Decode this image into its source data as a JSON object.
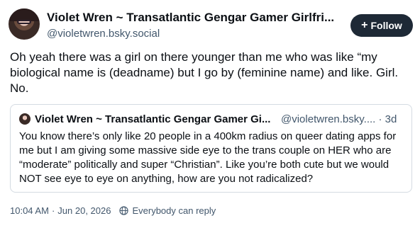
{
  "author": {
    "display_name": "Violet Wren ~ Transatlantic Gengar Gamer Girlfri...",
    "handle": "@violetwren.bsky.social"
  },
  "follow_button": {
    "icon": "plus-icon",
    "label": "Follow",
    "background": "#1e2936"
  },
  "post": {
    "text": "Oh yeah there was a girl on there younger than me who was like “my biological name is (deadname) but I go by (feminine name) and like. Girl. No."
  },
  "quote": {
    "display_name": "Violet Wren ~ Transatlantic Gengar Gamer Gi...",
    "handle": "@violetwren.bsky.... · 3d",
    "text": "You know there’s only like 20 people in a 400km radius on queer dating apps for me but I am giving some massive side eye to the trans couple on HER who are “moderate” politically and super “Christian”. Like you’re both cute but we would NOT see eye to eye on anything, how are you not radicalized?"
  },
  "meta": {
    "time": "10:04 AM",
    "separator": "·",
    "date": "Jun 20, 2026",
    "reply_icon": "globe-icon",
    "reply_setting": "Everybody can reply"
  },
  "colors": {
    "text": "#0b0f14",
    "secondary": "#42576c",
    "border": "#d4dbe2"
  }
}
